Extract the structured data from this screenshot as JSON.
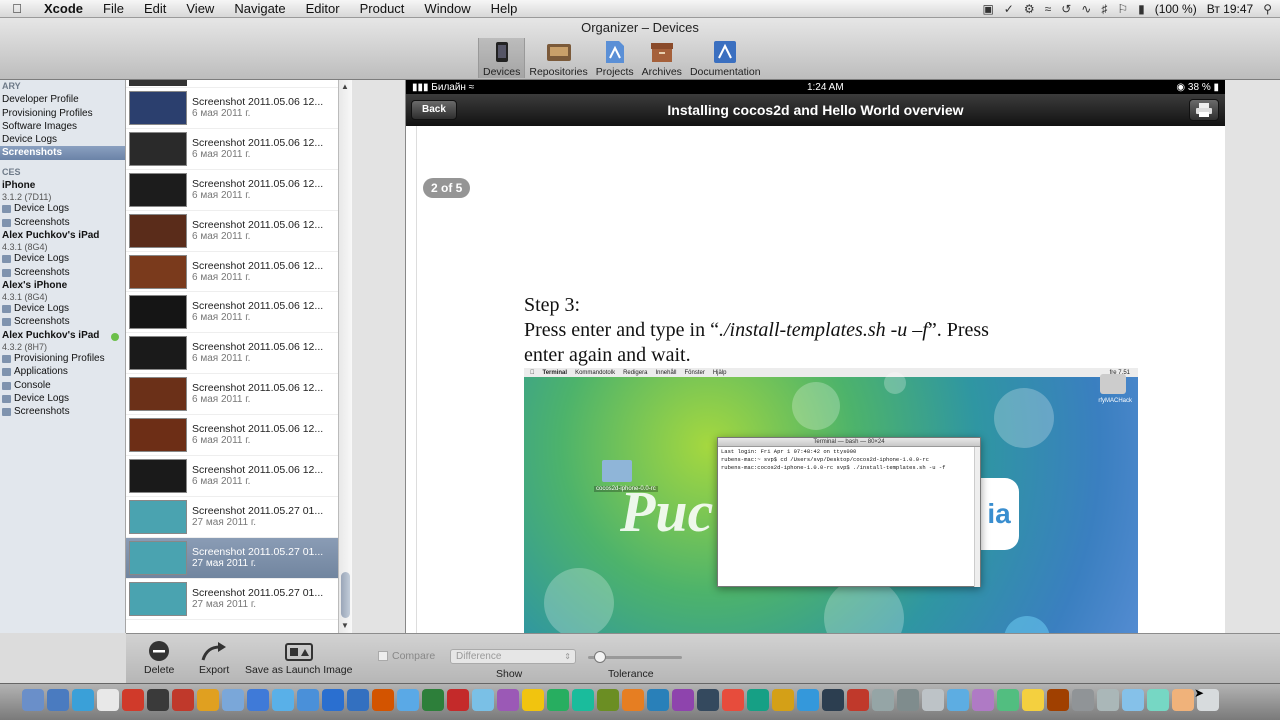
{
  "menubar": {
    "app": "Xcode",
    "items": [
      "File",
      "Edit",
      "View",
      "Navigate",
      "Editor",
      "Product",
      "Window",
      "Help"
    ],
    "battery": "(100 %)",
    "clock": "Вт 19:47"
  },
  "window": {
    "title": "Organizer – Devices",
    "tools": [
      "Devices",
      "Repositories",
      "Projects",
      "Archives",
      "Documentation"
    ]
  },
  "sidebar": {
    "library_header": "ARY",
    "library_items": [
      "Developer Profile",
      "Provisioning Profiles",
      "Software Images",
      "Device Logs",
      "Screenshots"
    ],
    "devices_header": "CES",
    "devices": [
      {
        "name": "iPhone",
        "version": "3.1.2 (7D11)",
        "items": [
          "Device Logs",
          "Screenshots"
        ]
      },
      {
        "name": "Alex Puchkov's iPad",
        "version": "4.3.1 (8G4)",
        "items": [
          "Device Logs",
          "Screenshots"
        ]
      },
      {
        "name": "Alex's iPhone",
        "version": "4.3.1 (8G4)",
        "items": [
          "Device Logs",
          "Screenshots"
        ]
      },
      {
        "name": "Alex Puchkov's iPad",
        "version": "4.3.2 (8H7)",
        "items": [
          "Provisioning Profiles",
          "Applications",
          "Console",
          "Device Logs",
          "Screenshots"
        ]
      }
    ]
  },
  "screenshots": [
    {
      "name": "Screenshot 2011.05.06 12...",
      "date": "6 мая 2011 г.",
      "thumb": "#2b3f6e"
    },
    {
      "name": "Screenshot 2011.05.06 12...",
      "date": "6 мая 2011 г.",
      "thumb": "#2a2a2a"
    },
    {
      "name": "Screenshot 2011.05.06 12...",
      "date": "6 мая 2011 г.",
      "thumb": "#1c1c1c"
    },
    {
      "name": "Screenshot 2011.05.06 12...",
      "date": "6 мая 2011 г.",
      "thumb": "#5a2c1a"
    },
    {
      "name": "Screenshot 2011.05.06 12...",
      "date": "6 мая 2011 г.",
      "thumb": "#7a3a1c"
    },
    {
      "name": "Screenshot 2011.05.06 12...",
      "date": "6 мая 2011 г.",
      "thumb": "#151515"
    },
    {
      "name": "Screenshot 2011.05.06 12...",
      "date": "6 мая 2011 г.",
      "thumb": "#1a1a1a"
    },
    {
      "name": "Screenshot 2011.05.06 12...",
      "date": "6 мая 2011 г.",
      "thumb": "#6b3018"
    },
    {
      "name": "Screenshot 2011.05.06 12...",
      "date": "6 мая 2011 г.",
      "thumb": "#6d2e16"
    },
    {
      "name": "Screenshot 2011.05.06 12...",
      "date": "6 мая 2011 г.",
      "thumb": "#1a1a1a"
    },
    {
      "name": "Screenshot 2011.05.27 01...",
      "date": "27 мая 2011 г.",
      "thumb": "#4aa3b0"
    },
    {
      "name": "Screenshot 2011.05.27 01...",
      "date": "27 мая 2011 г.",
      "thumb": "#4aa3b0"
    },
    {
      "name": "Screenshot 2011.05.27 01...",
      "date": "27 мая 2011 г.",
      "thumb": "#4aa3b0"
    }
  ],
  "device": {
    "carrier": "Билайн",
    "time": "1:24 AM",
    "battery": "38 %",
    "back_label": "Back",
    "nav_title": "Installing cocos2d and Hello World overview",
    "page_indicator": "2 of 5",
    "step_title": "Step 3:",
    "step_line1_a": "Press enter and type in “",
    "step_line1_cmd": "./install-templates.sh -u –f",
    "step_line1_b": "”. Press",
    "step_line2": "enter again and wait.",
    "inner_menu": [
      "Terminal",
      "Kommandotolk",
      "Redigera",
      "Innehåll",
      "Fönster",
      "Hjälp"
    ],
    "inner_clock": "fre 7.51",
    "hd_label": "rfyMACHack",
    "folder_label": "cocos2d-iphone-0.0-rc",
    "logo_left": "Puc",
    "logo_right": "ia",
    "terminal_title": "Terminal — bash — 80×24",
    "terminal_lines": [
      "Last login: Fri Apr  1 07:48:42 on ttys000",
      "rubens-mac:~ svp$ cd /Users/svp/Desktop/cocos2d-iphone-1.0.0-rc",
      "rubens-mac:cocos2d-iphone-1.0.0-rc svp$ ./install-templates.sh -u -f"
    ]
  },
  "bottom": {
    "delete": "Delete",
    "export": "Export",
    "save_launch": "Save as Launch Image",
    "compare": "Compare",
    "difference": "Difference",
    "show": "Show",
    "tolerance": "Tolerance"
  },
  "dock": {
    "colors": [
      "#6a8fc9",
      "#4a7bc0",
      "#3aa0d8",
      "#e8e8e8",
      "#d03a2a",
      "#3a3a3a",
      "#c0392b",
      "#e0a020",
      "#7aa7d9",
      "#3f7ad8",
      "#59b0e8",
      "#4a90d9",
      "#2a6fd0",
      "#3370c0",
      "#d35400",
      "#5aa9e6",
      "#2d7f3a",
      "#c42a2a",
      "#7ac0e6",
      "#9b59b6",
      "#f1c40f",
      "#27ae60",
      "#1abc9c",
      "#6b8e23",
      "#e67e22",
      "#2980b9",
      "#8e44ad",
      "#34495e",
      "#e74c3c",
      "#16a085",
      "#d4a017",
      "#3498db",
      "#2c3e50",
      "#c0392b",
      "#95a5a6",
      "#7f8c8d",
      "#bdc3c7",
      "#5dade2",
      "#af7ac5",
      "#52be80",
      "#f4d03f",
      "#a04000",
      "#909497",
      "#aab7b8",
      "#85c1e9",
      "#76d7c4",
      "#f0b27a",
      "#d7dbdd"
    ]
  }
}
